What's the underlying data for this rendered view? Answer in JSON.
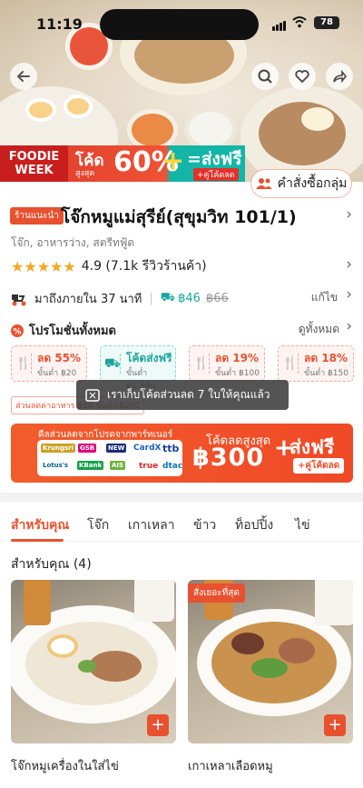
{
  "status": {
    "time": "11:19",
    "battery": "78"
  },
  "hero": {
    "foodie_week": [
      "FOODIE",
      "WEEK"
    ],
    "promo_code": "โค้ด",
    "promo_max": "สูงสุด",
    "promo_pct": "60%",
    "promo_free": "=ส่งฟรี",
    "promo_free_sub": "+คู่โค้ดลด",
    "group_order_label": "คำสั่งซื้อกลุ่ม"
  },
  "shop": {
    "tag": "ร้านแนะนำ",
    "name": "โจ๊กหมูแม่สุรีย์(สุขุมวิท 101/1)",
    "categories": "โจ๊ก, อาหารว่าง, สตรีทฟู้ด",
    "rating": "4.9 (7.1k รีวิวร้านค้า)",
    "delivery": "มาถึงภายใน 37 นาที",
    "delivery_fee": "฿46",
    "delivery_fee_old": "฿66",
    "change": "แก้ไข"
  },
  "promotions": {
    "title": "โปรโมชั่นทั้งหมด",
    "see_all": "ดูทั้งหมด",
    "coupons": [
      {
        "main": "ลด 55%",
        "sub": "ขั้นต่ำ ฿20"
      },
      {
        "main": "โค้ดส่งฟรี",
        "sub": "ขั้นต่ำ ฿1.5พัน"
      },
      {
        "main": "ลด 19%",
        "sub": "ขั้นต่ำ ฿100"
      },
      {
        "main": "ลด 18%",
        "sub": "ขั้นต่ำ ฿150"
      }
    ],
    "small_tag": "ส่วนลดค่าอาหาร ฿10 ขั้นต่ำ ฿200",
    "toast": "เราเก็บโค้ดส่วนลด 7 ใบให้คุณแล้ว"
  },
  "banner": {
    "partners": "ดีลส่วนลดจากโปรดจากพาร์ทเนอร์",
    "code": "โค้ดลดสูงสุด",
    "amount": "฿300",
    "free": "ส่งฟรี",
    "free_sub": "+คู่โค้ดลด",
    "partner_logos": [
      "Krungsri",
      "GSB",
      "NEW",
      "CardX",
      "ttb",
      "Lotus's",
      "KBank",
      "AIS",
      "true",
      "dtac"
    ]
  },
  "tabs": [
    "สำหรับคุณ",
    "โจ๊ก",
    "เกาเหลา",
    "ข้าว",
    "ท็อปปิ้ง",
    "ไข่"
  ],
  "section": {
    "title": "สำหรับคุณ (4)"
  },
  "products": [
    {
      "name": "โจ๊กหมูเครื่องในใส่ไข่",
      "badge": ""
    },
    {
      "name": "เกาเหลาเลือดหมู",
      "badge": "สั่งเยอะที่สุด"
    }
  ]
}
